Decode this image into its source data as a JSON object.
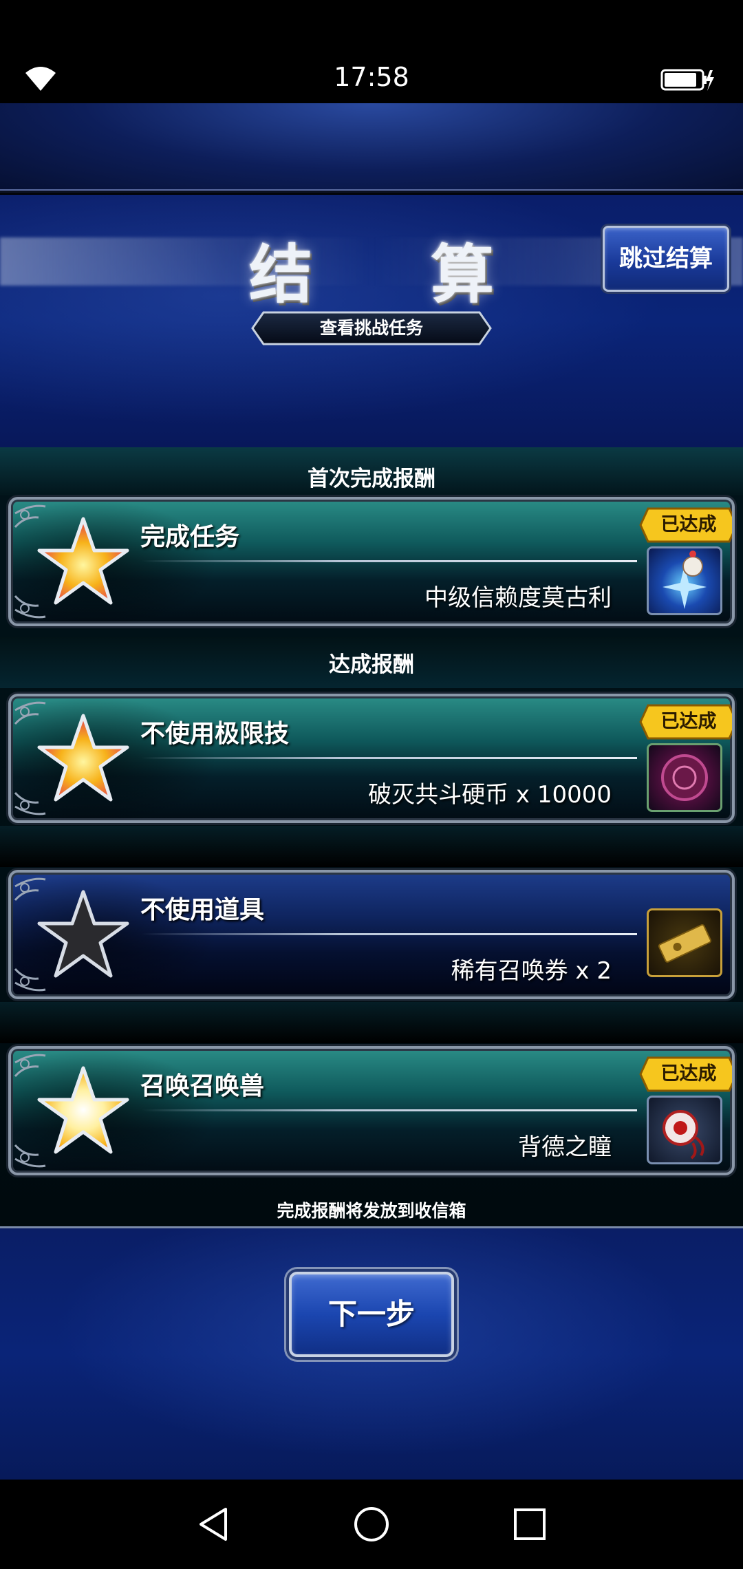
{
  "status_bar": {
    "time": "17:58"
  },
  "header": {
    "title": "结 算",
    "skip_label": "跳过结算",
    "view_challenge_label": "查看挑战任务"
  },
  "sections": {
    "first_completion": "首次完成报酬",
    "achievement": "达成报酬"
  },
  "missions": [
    {
      "title": "完成任务",
      "reward": "中级信赖度莫古利",
      "achieved": true,
      "badge": "已达成",
      "star": "gold",
      "reward_icon": "moogle-crystal-icon"
    },
    {
      "title": "不使用极限技",
      "reward": "破灭共斗硬币 x 10000",
      "achieved": true,
      "badge": "已达成",
      "star": "gold",
      "reward_icon": "coin-icon"
    },
    {
      "title": "不使用道具",
      "reward": "稀有召唤券 x 2",
      "achieved": false,
      "badge": "",
      "star": "gray",
      "reward_icon": "ticket-icon"
    },
    {
      "title": "召唤召唤兽",
      "reward": "背德之瞳",
      "achieved": true,
      "badge": "已达成",
      "star": "gold",
      "reward_icon": "eye-icon"
    }
  ],
  "footer_note": "完成报酬将发放到收信箱",
  "next_label": "下一步",
  "colors": {
    "accent_gold": "#f4c21a",
    "teal": "#1f7e7a",
    "blue": "#1a3a9a"
  }
}
